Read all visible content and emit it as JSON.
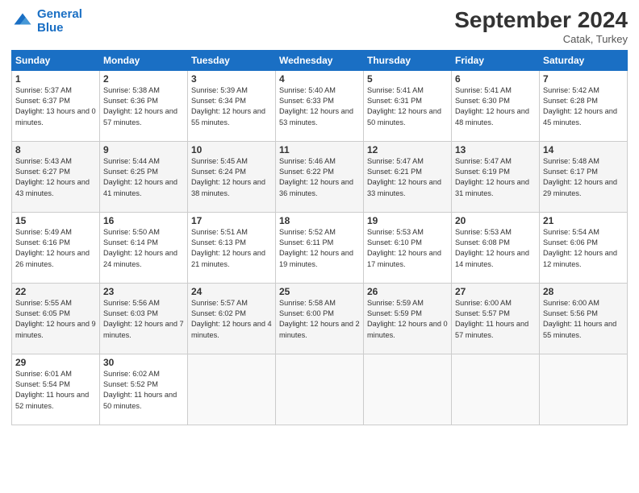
{
  "header": {
    "logo_line1": "General",
    "logo_line2": "Blue",
    "month": "September 2024",
    "location": "Catak, Turkey"
  },
  "days_of_week": [
    "Sunday",
    "Monday",
    "Tuesday",
    "Wednesday",
    "Thursday",
    "Friday",
    "Saturday"
  ],
  "weeks": [
    [
      {
        "day": 1,
        "sunrise": "5:37 AM",
        "sunset": "6:37 PM",
        "daylight": "13 hours and 0 minutes."
      },
      {
        "day": 2,
        "sunrise": "5:38 AM",
        "sunset": "6:36 PM",
        "daylight": "12 hours and 57 minutes."
      },
      {
        "day": 3,
        "sunrise": "5:39 AM",
        "sunset": "6:34 PM",
        "daylight": "12 hours and 55 minutes."
      },
      {
        "day": 4,
        "sunrise": "5:40 AM",
        "sunset": "6:33 PM",
        "daylight": "12 hours and 53 minutes."
      },
      {
        "day": 5,
        "sunrise": "5:41 AM",
        "sunset": "6:31 PM",
        "daylight": "12 hours and 50 minutes."
      },
      {
        "day": 6,
        "sunrise": "5:41 AM",
        "sunset": "6:30 PM",
        "daylight": "12 hours and 48 minutes."
      },
      {
        "day": 7,
        "sunrise": "5:42 AM",
        "sunset": "6:28 PM",
        "daylight": "12 hours and 45 minutes."
      }
    ],
    [
      {
        "day": 8,
        "sunrise": "5:43 AM",
        "sunset": "6:27 PM",
        "daylight": "12 hours and 43 minutes."
      },
      {
        "day": 9,
        "sunrise": "5:44 AM",
        "sunset": "6:25 PM",
        "daylight": "12 hours and 41 minutes."
      },
      {
        "day": 10,
        "sunrise": "5:45 AM",
        "sunset": "6:24 PM",
        "daylight": "12 hours and 38 minutes."
      },
      {
        "day": 11,
        "sunrise": "5:46 AM",
        "sunset": "6:22 PM",
        "daylight": "12 hours and 36 minutes."
      },
      {
        "day": 12,
        "sunrise": "5:47 AM",
        "sunset": "6:21 PM",
        "daylight": "12 hours and 33 minutes."
      },
      {
        "day": 13,
        "sunrise": "5:47 AM",
        "sunset": "6:19 PM",
        "daylight": "12 hours and 31 minutes."
      },
      {
        "day": 14,
        "sunrise": "5:48 AM",
        "sunset": "6:17 PM",
        "daylight": "12 hours and 29 minutes."
      }
    ],
    [
      {
        "day": 15,
        "sunrise": "5:49 AM",
        "sunset": "6:16 PM",
        "daylight": "12 hours and 26 minutes."
      },
      {
        "day": 16,
        "sunrise": "5:50 AM",
        "sunset": "6:14 PM",
        "daylight": "12 hours and 24 minutes."
      },
      {
        "day": 17,
        "sunrise": "5:51 AM",
        "sunset": "6:13 PM",
        "daylight": "12 hours and 21 minutes."
      },
      {
        "day": 18,
        "sunrise": "5:52 AM",
        "sunset": "6:11 PM",
        "daylight": "12 hours and 19 minutes."
      },
      {
        "day": 19,
        "sunrise": "5:53 AM",
        "sunset": "6:10 PM",
        "daylight": "12 hours and 17 minutes."
      },
      {
        "day": 20,
        "sunrise": "5:53 AM",
        "sunset": "6:08 PM",
        "daylight": "12 hours and 14 minutes."
      },
      {
        "day": 21,
        "sunrise": "5:54 AM",
        "sunset": "6:06 PM",
        "daylight": "12 hours and 12 minutes."
      }
    ],
    [
      {
        "day": 22,
        "sunrise": "5:55 AM",
        "sunset": "6:05 PM",
        "daylight": "12 hours and 9 minutes."
      },
      {
        "day": 23,
        "sunrise": "5:56 AM",
        "sunset": "6:03 PM",
        "daylight": "12 hours and 7 minutes."
      },
      {
        "day": 24,
        "sunrise": "5:57 AM",
        "sunset": "6:02 PM",
        "daylight": "12 hours and 4 minutes."
      },
      {
        "day": 25,
        "sunrise": "5:58 AM",
        "sunset": "6:00 PM",
        "daylight": "12 hours and 2 minutes."
      },
      {
        "day": 26,
        "sunrise": "5:59 AM",
        "sunset": "5:59 PM",
        "daylight": "12 hours and 0 minutes."
      },
      {
        "day": 27,
        "sunrise": "6:00 AM",
        "sunset": "5:57 PM",
        "daylight": "11 hours and 57 minutes."
      },
      {
        "day": 28,
        "sunrise": "6:00 AM",
        "sunset": "5:56 PM",
        "daylight": "11 hours and 55 minutes."
      }
    ],
    [
      {
        "day": 29,
        "sunrise": "6:01 AM",
        "sunset": "5:54 PM",
        "daylight": "11 hours and 52 minutes."
      },
      {
        "day": 30,
        "sunrise": "6:02 AM",
        "sunset": "5:52 PM",
        "daylight": "11 hours and 50 minutes."
      },
      null,
      null,
      null,
      null,
      null
    ]
  ]
}
